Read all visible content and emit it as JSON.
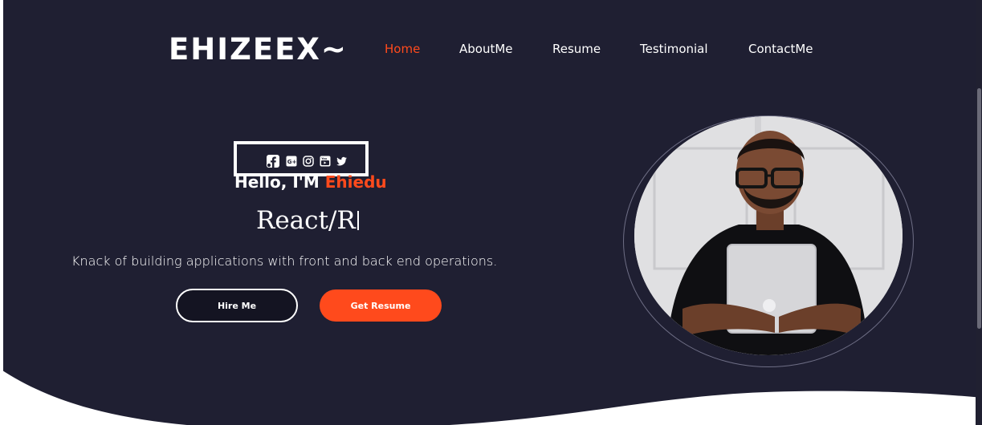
{
  "brand": {
    "logo": "EHIZEEX~"
  },
  "nav": {
    "items": [
      {
        "label": "Home",
        "active": true
      },
      {
        "label": "AboutMe",
        "active": false
      },
      {
        "label": "Resume",
        "active": false
      },
      {
        "label": "Testimonial",
        "active": false
      },
      {
        "label": "ContactMe",
        "active": false
      }
    ]
  },
  "social": {
    "icons": [
      "facebook-icon",
      "google-plus-icon",
      "instagram-icon",
      "youtube-icon",
      "twitter-icon"
    ]
  },
  "hero": {
    "greeting": "Hello, I'M ",
    "name": "Ehiedu",
    "typed_role": "React/R",
    "tagline": "Knack of building applications with front and back end operations."
  },
  "buttons": {
    "hire": "Hire Me",
    "resume": "Get Resume"
  },
  "colors": {
    "background": "#1f1f32",
    "accent": "#ff4a1c",
    "text": "#ffffff"
  }
}
